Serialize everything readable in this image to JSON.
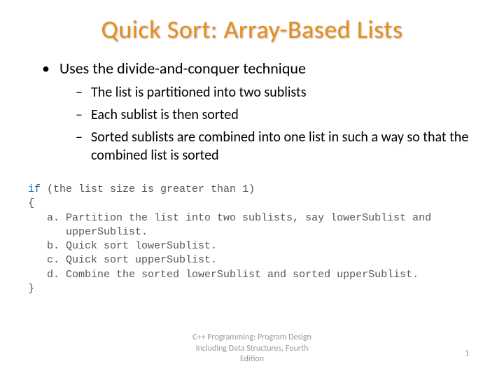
{
  "title": "Quick Sort: Array-Based Lists",
  "bullets": {
    "main": "Uses the divide-and-conquer technique",
    "sub1": "The list is partitioned into two sublists",
    "sub2": "Each sublist is then sorted",
    "sub3": "Sorted sublists are combined into one list in such a way so that the combined list is sorted"
  },
  "code": {
    "keyword": "if",
    "cond": " (the list size is greater than 1)",
    "open": "{",
    "a": "   a. Partition the list into two sublists, say lowerSublist and",
    "a2": "      upperSublist.",
    "b": "   b. Quick sort lowerSublist.",
    "c": "   c. Quick sort upperSublist.",
    "d": "   d. Combine the sorted lowerSublist and sorted upperSublist.",
    "close": "}"
  },
  "footer": {
    "line1": "C++ Programming: Program Design",
    "line2": "Including Data Structures, Fourth",
    "line3": "Edition"
  },
  "pageNumber": "1"
}
